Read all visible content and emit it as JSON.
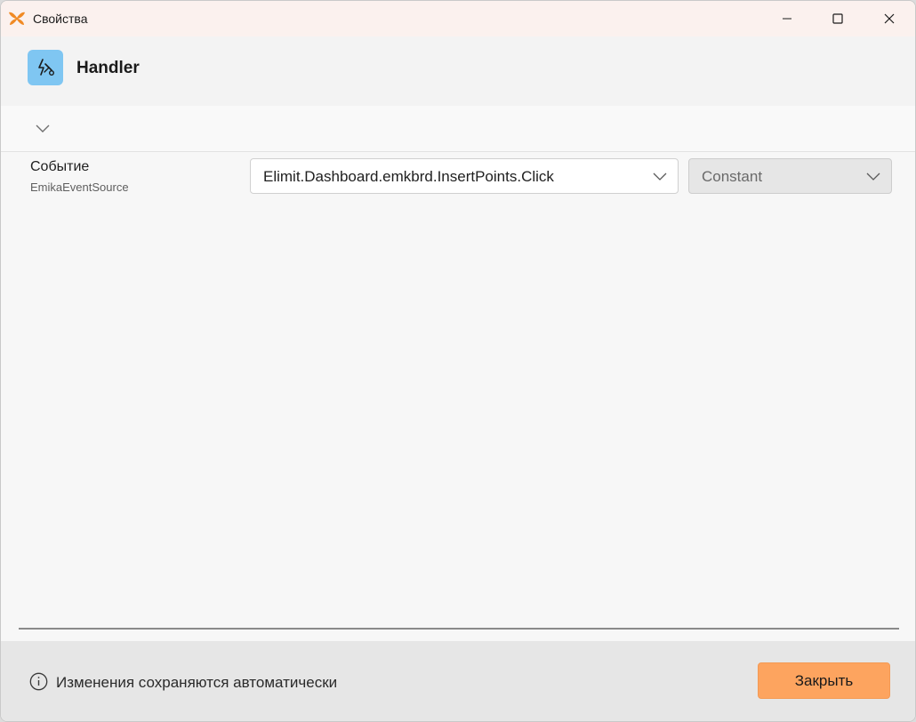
{
  "window": {
    "title": "Свойства",
    "app_icon": "butterfly-icon",
    "accent_color": "#f08a24"
  },
  "header": {
    "title": "Handler",
    "icon": "lightning-handler-icon",
    "icon_bg": "#7fc6f2"
  },
  "collapse": {
    "icon": "chevron-down-icon"
  },
  "property": {
    "label": "Событие",
    "sublabel": "EmikaEventSource",
    "event_value": "Elimit.Dashboard.emkbrd.InsertPoints.Click",
    "mode_value": "Constant"
  },
  "footer": {
    "info_text": "Изменения сохраняются автоматически",
    "close_label": "Закрыть",
    "close_color": "#fda45f"
  }
}
